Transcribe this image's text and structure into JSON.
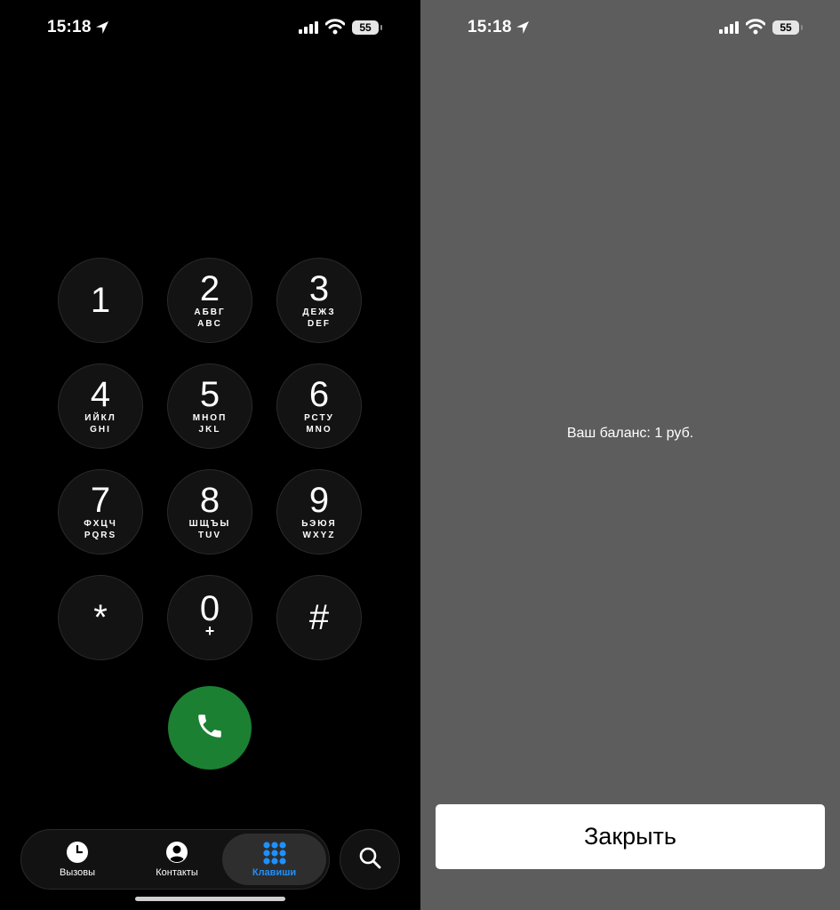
{
  "left": {
    "status": {
      "time": "15:18",
      "battery": "55"
    },
    "keys": [
      {
        "digit": "1",
        "letters_ru": "",
        "letters_en": ""
      },
      {
        "digit": "2",
        "letters_ru": "АБВГ",
        "letters_en": "ABC"
      },
      {
        "digit": "3",
        "letters_ru": "ДЕЖЗ",
        "letters_en": "DEF"
      },
      {
        "digit": "4",
        "letters_ru": "ИЙКЛ",
        "letters_en": "GHI"
      },
      {
        "digit": "5",
        "letters_ru": "МНОП",
        "letters_en": "JKL"
      },
      {
        "digit": "6",
        "letters_ru": "РСТУ",
        "letters_en": "MNO"
      },
      {
        "digit": "7",
        "letters_ru": "ФХЦЧ",
        "letters_en": "PQRS"
      },
      {
        "digit": "8",
        "letters_ru": "ШЩЪЫ",
        "letters_en": "TUV"
      },
      {
        "digit": "9",
        "letters_ru": "ЬЭЮЯ",
        "letters_en": "WXYZ"
      },
      {
        "digit": "*",
        "letters_ru": "",
        "letters_en": ""
      },
      {
        "digit": "0",
        "letters_ru": "+",
        "letters_en": ""
      },
      {
        "digit": "#",
        "letters_ru": "",
        "letters_en": ""
      }
    ],
    "call_icon": "phone-icon",
    "tabs": [
      {
        "label": "Вызовы",
        "icon": "clock-icon",
        "active": false
      },
      {
        "label": "Контакты",
        "icon": "person-circle-icon",
        "active": false
      },
      {
        "label": "Клавиши",
        "icon": "keypad-icon",
        "active": true
      }
    ],
    "search_icon": "search-icon",
    "active_color": "#1e90ff",
    "call_color": "#1c8033"
  },
  "right": {
    "status": {
      "time": "15:18",
      "battery": "55"
    },
    "message": "Ваш баланс: 1 руб.",
    "close_label": "Закрыть"
  }
}
